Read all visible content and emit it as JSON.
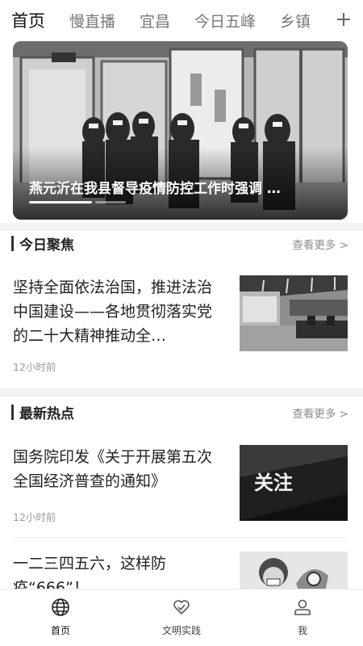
{
  "tabs": [
    "首页",
    "慢直播",
    "宜昌",
    "今日五峰",
    "乡镇"
  ],
  "banner": {
    "title": "燕元沂在我县督导疫情防控工作时强调 …"
  },
  "sections": {
    "focus": {
      "title": "今日聚焦",
      "more": "查看更多 >"
    },
    "hot": {
      "title": "最新热点",
      "more": "查看更多 >"
    }
  },
  "articles": {
    "focus_1": {
      "title": "坚持全面依法治国，推进法治中国建设——各地贯彻落实党的二十大精神推动全…",
      "time": "12小时前"
    },
    "hot_1": {
      "title": "国务院印发《关于开展第五次全国经济普查的通知》",
      "time": "12小时前",
      "thumb_text": "关注"
    },
    "hot_2": {
      "title": "一二三四五六，这样防疫“666”！"
    }
  },
  "nav": {
    "home": "首页",
    "practice": "文明实践",
    "me": "我"
  },
  "colors": {
    "text": "#222222",
    "muted": "#999999",
    "divider": "#ececec"
  }
}
